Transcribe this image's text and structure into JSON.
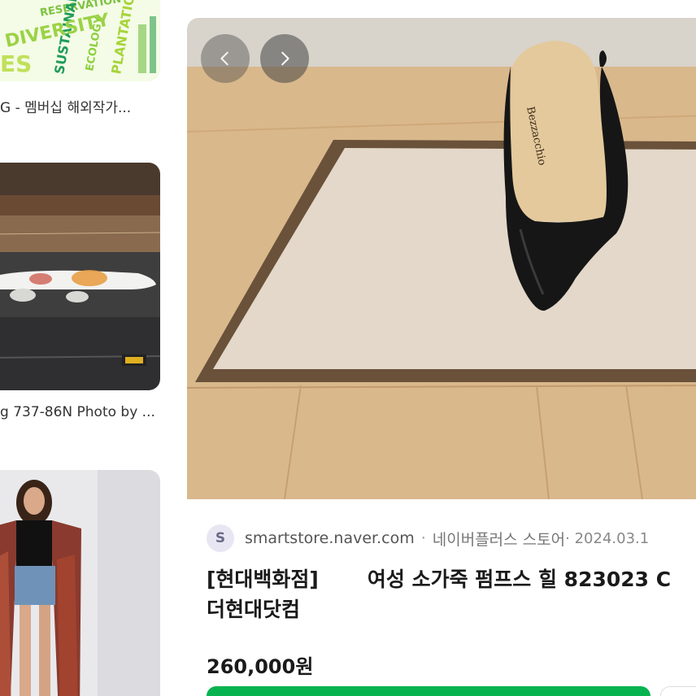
{
  "left_results": [
    {
      "caption": "G - 멤버십 해외작가...",
      "image_words": [
        "SUSTAINABLE",
        "PLANTATION",
        "DIVERSITY",
        "RESERVATION",
        "ECOLOGY",
        "ES"
      ]
    },
    {
      "caption": "g 737-86N Photo by ...",
      "image_words": []
    },
    {
      "caption": "",
      "image_words": []
    }
  ],
  "preview": {
    "nav_prev_icon": "chevron-left-icon",
    "nav_next_icon": "chevron-right-icon",
    "shoe_brand": "Bezzacchio",
    "source": {
      "site_initial": "S",
      "domain": "smartstore.naver.com",
      "separator": "·",
      "store": "네이버플러스 스토어",
      "date": "· 2024.03.1"
    },
    "title_part1": "[현대백화점]",
    "title_part2": "여성 소가죽 펌프스 힐 823023 C",
    "title_line2": "더현대닷컴",
    "price": "260,000원"
  },
  "colors": {
    "buy_button": "#07b34f",
    "nav_button": "#464646",
    "floor": "#d9b88c"
  }
}
